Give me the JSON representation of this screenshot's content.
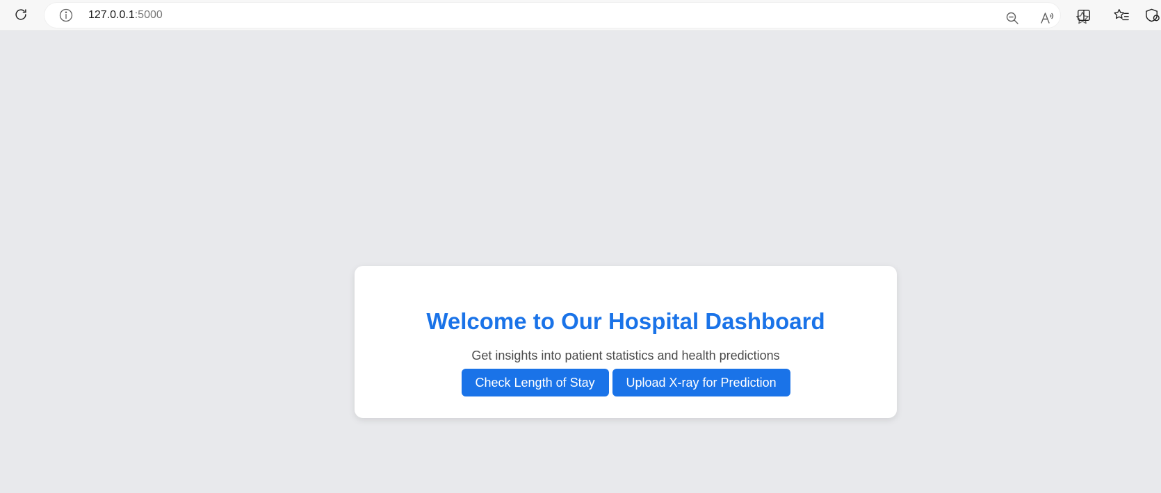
{
  "browser": {
    "address_bar": {
      "url_host": "127.0.0.1",
      "url_port": ":5000"
    },
    "icons": {
      "reload": "reload-icon",
      "site_info": "info-icon",
      "zoom": "zoom-out-icon",
      "read_aloud": "read-aloud-icon",
      "favorite": "star-icon",
      "split_screen": "split-screen-icon",
      "favorites": "favorites-list-icon",
      "extensions": "browser-essentials-icon"
    }
  },
  "page": {
    "card": {
      "title": "Welcome to Our Hospital Dashboard",
      "subtitle": "Get insights into patient statistics and health predictions",
      "buttons": [
        {
          "label": "Check Length of Stay"
        },
        {
          "label": "Upload X-ray for Prediction"
        }
      ]
    }
  },
  "colors": {
    "accent": "#1a73e8",
    "page_background": "#e8e9ec",
    "card_background": "#ffffff",
    "subtitle_text": "#4a4a4a"
  }
}
